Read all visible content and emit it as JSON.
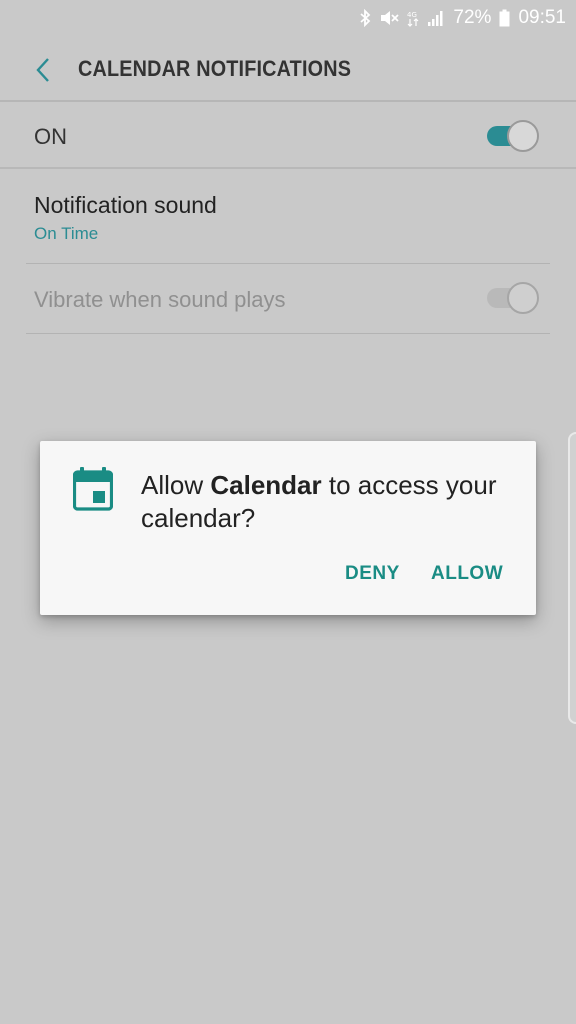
{
  "status_bar": {
    "battery": "72%",
    "time": "09:51",
    "icons": [
      "bluetooth-icon",
      "mute-icon",
      "data-icon",
      "signal-icon",
      "battery-icon"
    ]
  },
  "header": {
    "title": "CALENDAR NOTIFICATIONS"
  },
  "settings": {
    "on_label": "ON",
    "on_enabled": true,
    "sound_title": "Notification sound",
    "sound_value": "On Time",
    "vibrate_title": "Vibrate when sound plays",
    "vibrate_enabled": false
  },
  "dialog": {
    "prefix": "Allow ",
    "app_name": "Calendar",
    "suffix": " to access your calendar?",
    "deny_label": "DENY",
    "allow_label": "ALLOW"
  },
  "colors": {
    "accent": "#2b8c93",
    "button_text": "#1a8c84",
    "background_dimmed": "#c9c9c9"
  }
}
